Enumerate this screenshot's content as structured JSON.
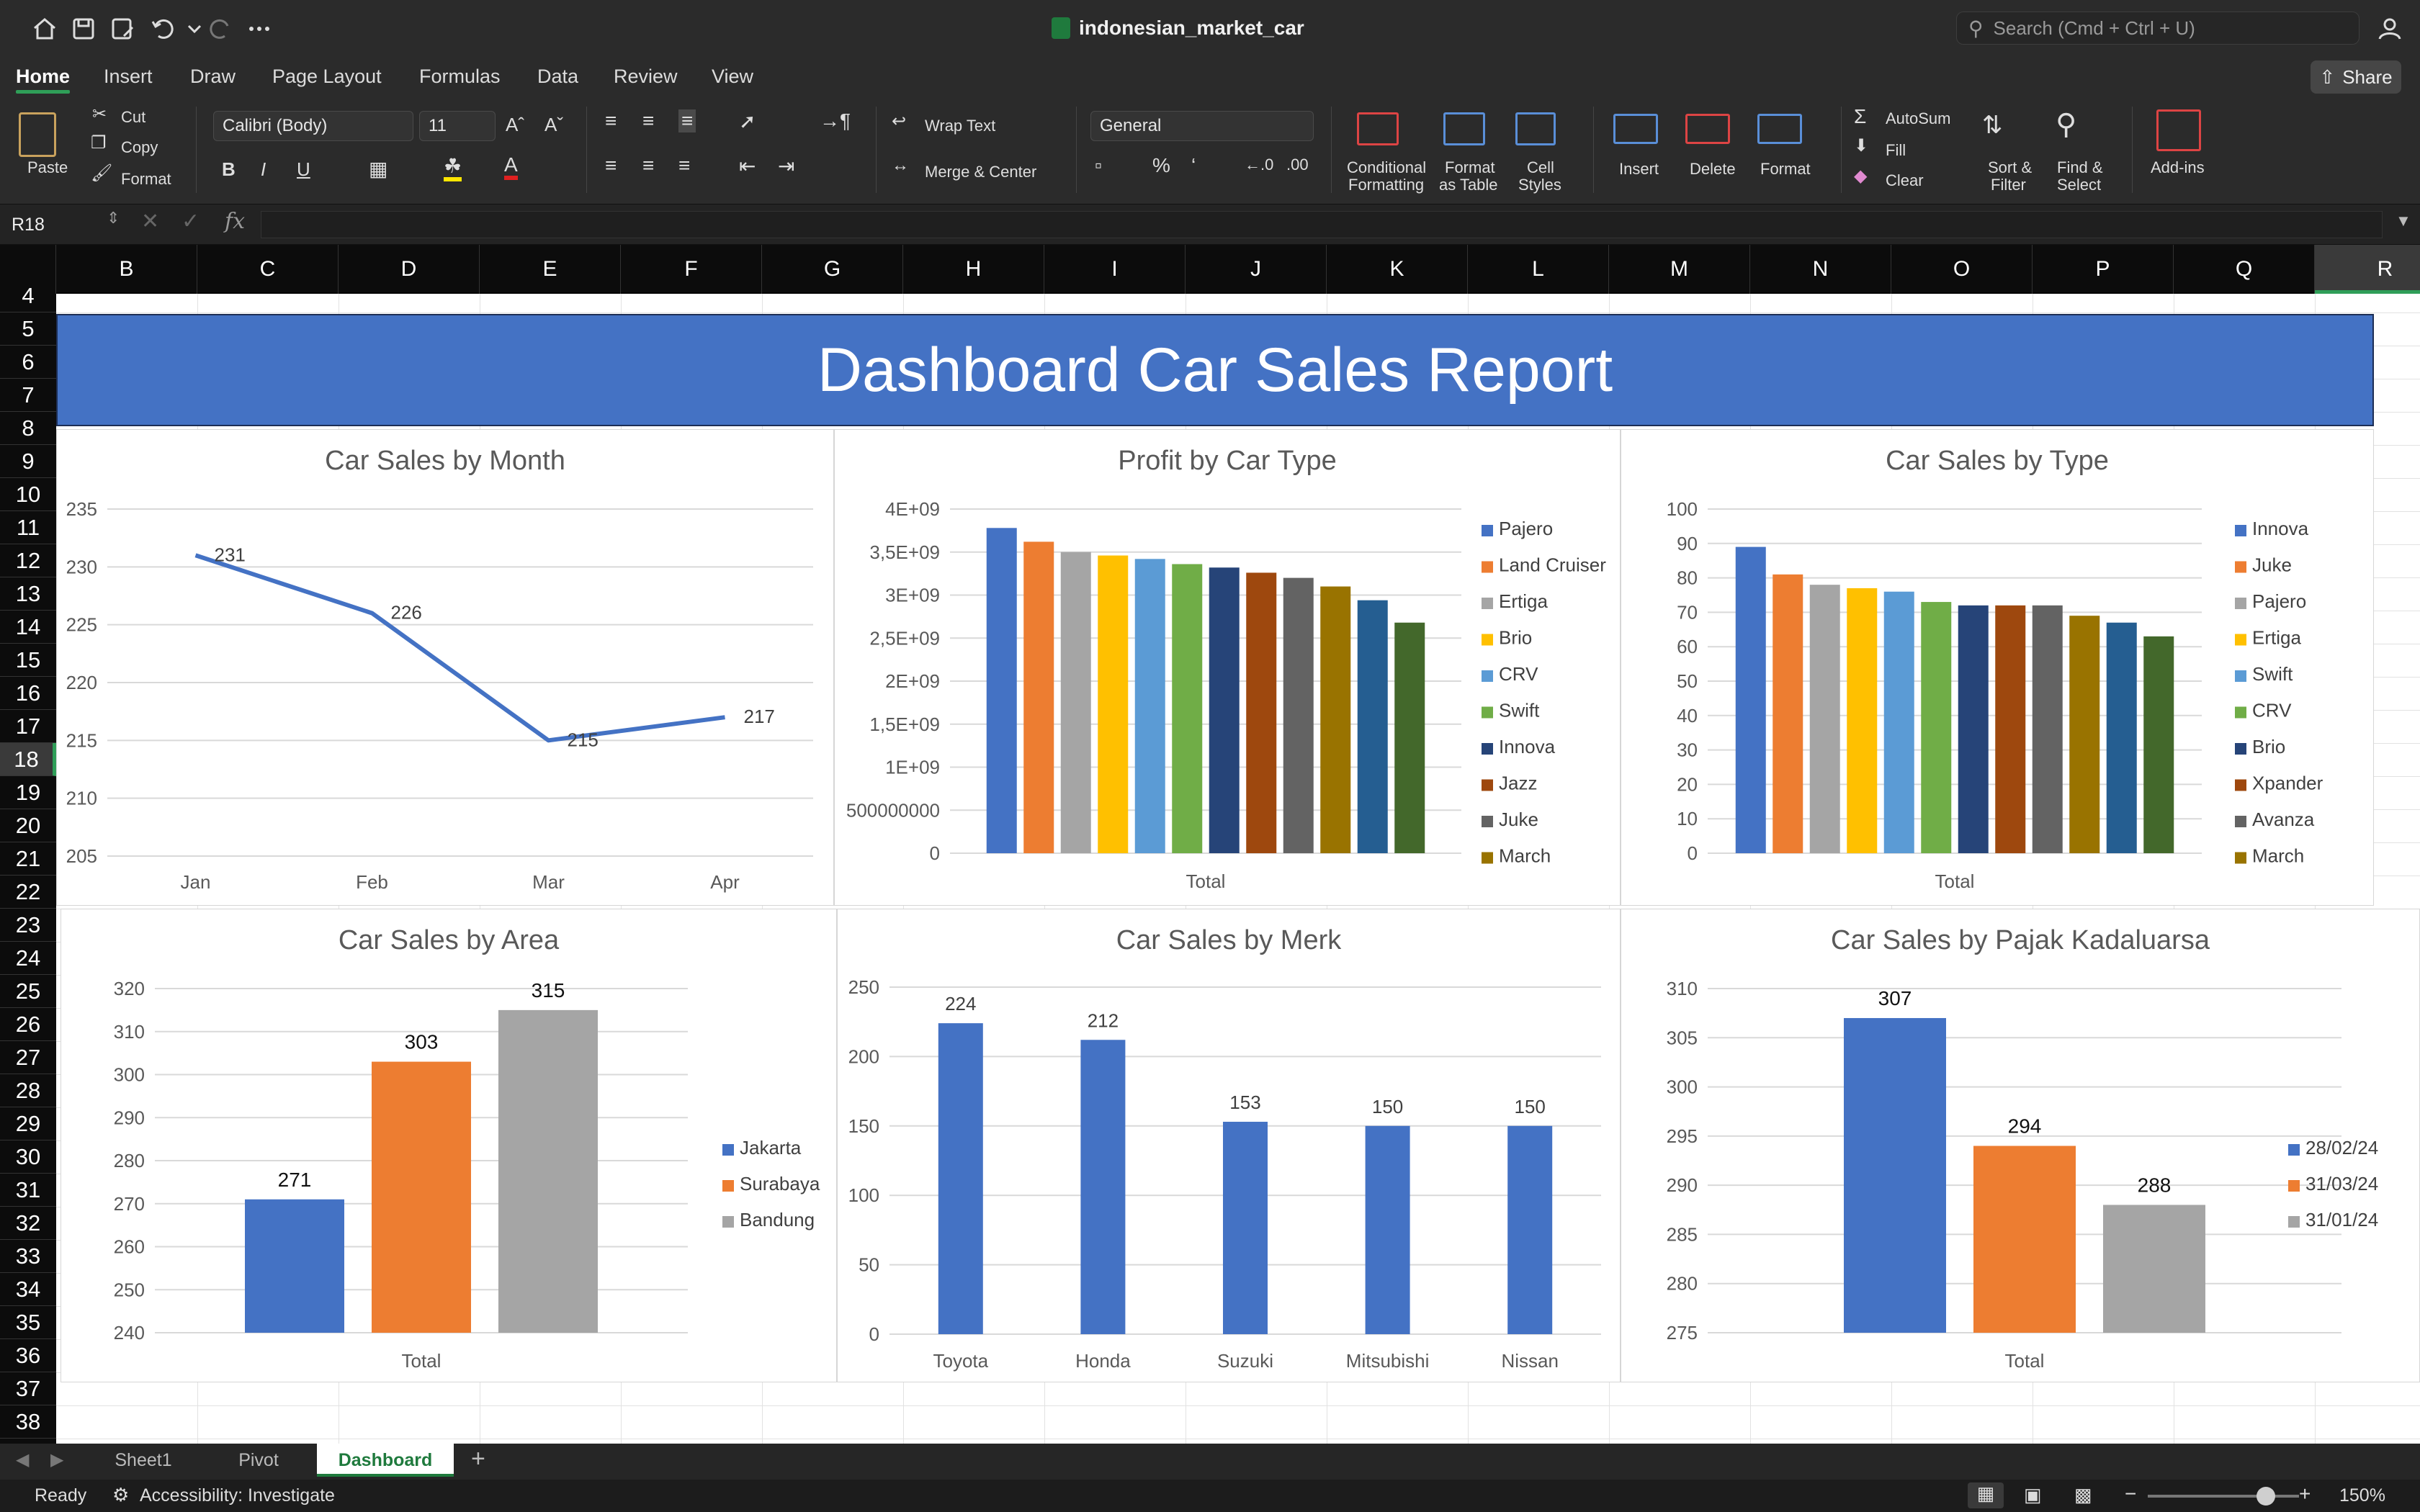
{
  "app": {
    "doc_title": "indonesian_market_car",
    "search_placeholder": "Search (Cmd + Ctrl + U)",
    "share_label": "Share"
  },
  "menu": [
    "Home",
    "Insert",
    "Draw",
    "Page Layout",
    "Formulas",
    "Data",
    "Review",
    "View"
  ],
  "ribbon": {
    "paste": "Paste",
    "cut": "Cut",
    "copy": "Copy",
    "format_painter": "Format",
    "font_name": "Calibri (Body)",
    "font_size": "11",
    "bold": "B",
    "italic": "I",
    "underline": "U",
    "wrap_text": "Wrap Text",
    "merge_center": "Merge & Center",
    "number_format": "General",
    "cond_format_1": "Conditional",
    "cond_format_2": "Formatting",
    "format_table_1": "Format",
    "format_table_2": "as Table",
    "cell_styles_1": "Cell",
    "cell_styles_2": "Styles",
    "insert": "Insert",
    "delete": "Delete",
    "format": "Format",
    "autosum": "AutoSum",
    "fill": "Fill",
    "clear": "Clear",
    "sort_1": "Sort &",
    "sort_2": "Filter",
    "find_1": "Find &",
    "find_2": "Select",
    "addins": "Add-ins"
  },
  "formula_bar": {
    "name_box": "R18",
    "fx": "fx",
    "value": ""
  },
  "columns": [
    "B",
    "C",
    "D",
    "E",
    "F",
    "G",
    "H",
    "I",
    "J",
    "K",
    "L",
    "M",
    "N",
    "O",
    "P",
    "Q",
    "R"
  ],
  "selected_column": "R",
  "rows": [
    "4",
    "5",
    "6",
    "7",
    "8",
    "9",
    "10",
    "11",
    "12",
    "13",
    "14",
    "15",
    "16",
    "17",
    "18",
    "19",
    "20",
    "21",
    "22",
    "23",
    "24",
    "25",
    "26",
    "27",
    "28",
    "29",
    "30",
    "31",
    "32",
    "33",
    "34",
    "35",
    "36",
    "37",
    "38"
  ],
  "selected_row": "18",
  "dashboard_title": "Dashboard Car Sales Report",
  "colors": {
    "blue": "#4472c4",
    "orange": "#ed7d31",
    "gray": "#a5a5a5",
    "gold": "#ffc000",
    "lightblue": "#5b9bd5",
    "green": "#70ad47",
    "navy": "#264478",
    "brown": "#9e480e",
    "darkgray": "#636363",
    "olive": "#997300",
    "steel": "#255e91",
    "darkgreen": "#43682b"
  },
  "chart_data": [
    {
      "id": "month",
      "type": "line",
      "title": "Car Sales by Month",
      "categories": [
        "Jan",
        "Feb",
        "Mar",
        "Apr"
      ],
      "values": [
        231,
        226,
        215,
        217
      ],
      "ylim": [
        205,
        235
      ],
      "yticks": [
        "205",
        "210",
        "215",
        "220",
        "225",
        "230",
        "235"
      ]
    },
    {
      "id": "profit",
      "type": "bar",
      "title": "Profit by Car Type",
      "xlabel": "Total",
      "ylim": [
        0,
        4000000000
      ],
      "yticks": [
        "0",
        "500000000",
        "1E+09",
        "1,5E+09",
        "2E+09",
        "2,5E+09",
        "3E+09",
        "3,5E+09",
        "4E+09"
      ],
      "series": [
        {
          "name": "Pajero",
          "value": 3780000000
        },
        {
          "name": "Land Cruiser",
          "value": 3620000000
        },
        {
          "name": "Ertiga",
          "value": 3500000000
        },
        {
          "name": "Brio",
          "value": 3460000000
        },
        {
          "name": "CRV",
          "value": 3420000000
        },
        {
          "name": "Swift",
          "value": 3360000000
        },
        {
          "name": "Innova",
          "value": 3320000000
        },
        {
          "name": "Jazz",
          "value": 3260000000
        },
        {
          "name": "Juke",
          "value": 3200000000
        },
        {
          "name": "March",
          "value": 3100000000
        },
        {
          "name": "",
          "value": 2940000000
        },
        {
          "name": "",
          "value": 2680000000
        }
      ]
    },
    {
      "id": "type",
      "type": "bar",
      "title": "Car Sales by Type",
      "xlabel": "Total",
      "ylim": [
        0,
        100
      ],
      "yticks": [
        "0",
        "10",
        "20",
        "30",
        "40",
        "50",
        "60",
        "70",
        "80",
        "90",
        "100"
      ],
      "series": [
        {
          "name": "Innova",
          "value": 89
        },
        {
          "name": "Juke",
          "value": 81
        },
        {
          "name": "Pajero",
          "value": 78
        },
        {
          "name": "Ertiga",
          "value": 77
        },
        {
          "name": "Swift",
          "value": 76
        },
        {
          "name": "CRV",
          "value": 73
        },
        {
          "name": "Brio",
          "value": 72
        },
        {
          "name": "Xpander",
          "value": 72
        },
        {
          "name": "Avanza",
          "value": 72
        },
        {
          "name": "March",
          "value": 69
        },
        {
          "name": "",
          "value": 67
        },
        {
          "name": "",
          "value": 63
        }
      ]
    },
    {
      "id": "area",
      "type": "bar",
      "title": "Car Sales by Area",
      "xlabel": "Total",
      "ylim": [
        240,
        320
      ],
      "yticks": [
        "240",
        "250",
        "260",
        "270",
        "280",
        "290",
        "300",
        "310",
        "320"
      ],
      "series": [
        {
          "name": "Jakarta",
          "value": 271
        },
        {
          "name": "Surabaya",
          "value": 303
        },
        {
          "name": "Bandung",
          "value": 315
        }
      ]
    },
    {
      "id": "merk",
      "type": "bar",
      "title": "Car Sales by Merk",
      "categories": [
        "Toyota",
        "Honda",
        "Suzuki",
        "Mitsubishi",
        "Nissan"
      ],
      "values": [
        224,
        212,
        153,
        150,
        150
      ],
      "ylim": [
        0,
        250
      ],
      "yticks": [
        "0",
        "50",
        "100",
        "150",
        "200",
        "250"
      ]
    },
    {
      "id": "pajak",
      "type": "bar",
      "title": "Car Sales by Pajak Kadaluarsa",
      "xlabel": "Total",
      "ylim": [
        275,
        310
      ],
      "yticks": [
        "275",
        "280",
        "285",
        "290",
        "295",
        "300",
        "305",
        "310"
      ],
      "series": [
        {
          "name": "28/02/24",
          "value": 307
        },
        {
          "name": "31/03/24",
          "value": 294
        },
        {
          "name": "31/01/24",
          "value": 288
        }
      ]
    }
  ],
  "sheets": [
    "Sheet1",
    "Pivot",
    "Dashboard"
  ],
  "active_sheet": "Dashboard",
  "status": {
    "ready": "Ready",
    "accessibility": "Accessibility: Investigate",
    "zoom": "150%",
    "zoom_level": 0.78
  }
}
